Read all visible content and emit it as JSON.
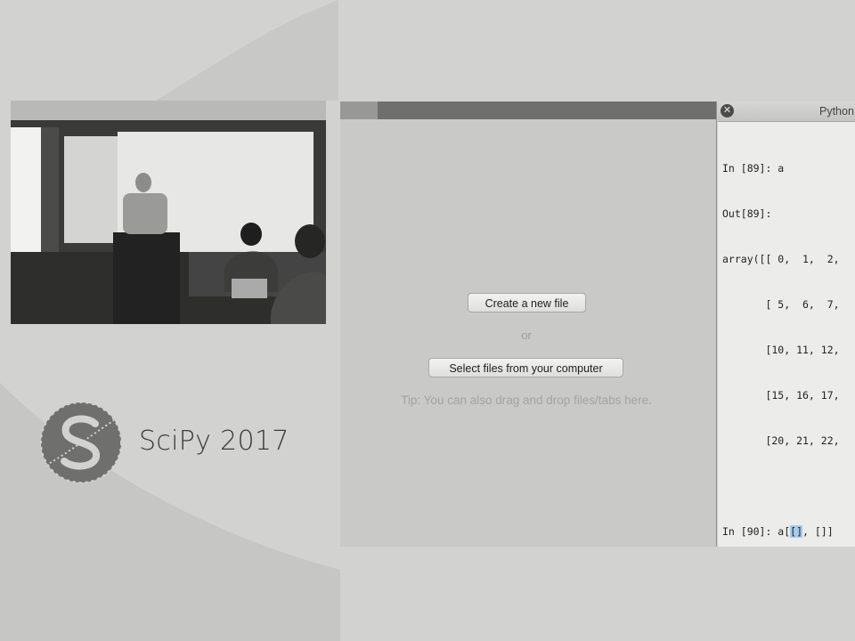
{
  "branding": {
    "event_name": "SciPy 2017",
    "logo_icon": "scipy-s-logo-icon"
  },
  "editor": {
    "create_button_label": "Create a new file",
    "or_label": "or",
    "select_button_label": "Select files from your computer",
    "tip_text": "Tip: You can also drag and drop files/tabs here."
  },
  "console": {
    "title": "Python",
    "close_icon_glyph": "✕",
    "lines": {
      "l0": "In [89]: a",
      "l1": "Out[89]:",
      "l2": "array([[ 0,  1,  2,",
      "l3": "       [ 5,  6,  7,",
      "l4": "       [10, 11, 12,",
      "l5": "       [15, 16, 17,",
      "l6": "       [20, 21, 22,",
      "l7": "",
      "l8_prefix": "In [90]: a[",
      "l8_cursor": "[]",
      "l8_suffix": ", []]"
    }
  },
  "colors": {
    "background": "#d2d2d0",
    "editor_bg": "#c9c9c7",
    "console_bg": "#ececea"
  }
}
